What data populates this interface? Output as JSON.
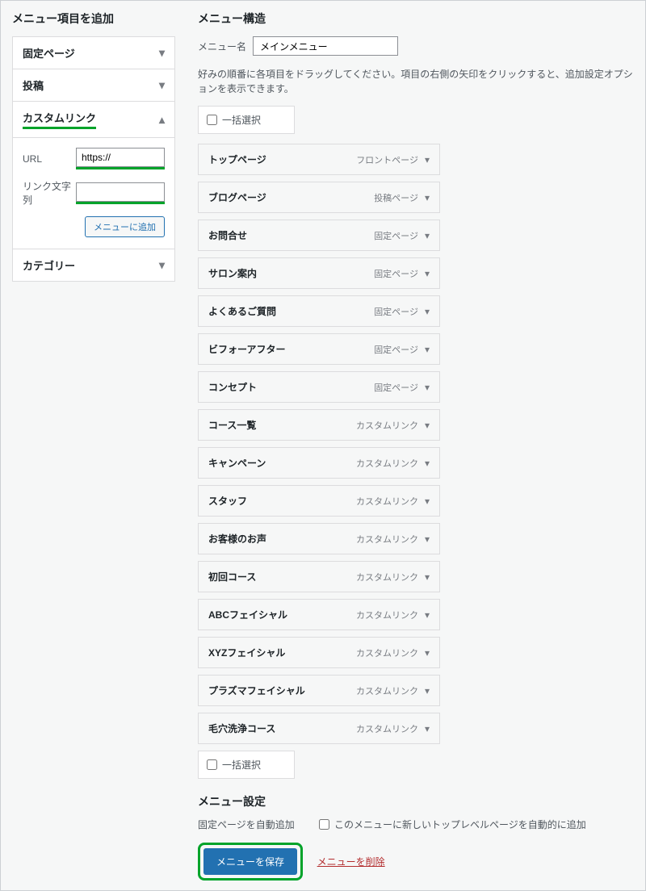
{
  "left": {
    "heading": "メニュー項目を追加",
    "panels": [
      {
        "label": "固定ページ",
        "open": false
      },
      {
        "label": "投稿",
        "open": false
      },
      {
        "label": "カスタムリンク",
        "open": true
      },
      {
        "label": "カテゴリー",
        "open": false
      }
    ],
    "custom_link": {
      "url_label": "URL",
      "url_value": "https://",
      "text_label": "リンク文字列",
      "text_value": "",
      "add_btn": "メニューに追加"
    }
  },
  "right": {
    "heading": "メニュー構造",
    "menu_name_label": "メニュー名",
    "menu_name_value": "メインメニュー",
    "instructions": "好みの順番に各項目をドラッグしてください。項目の右側の矢印をクリックすると、追加設定オプションを表示できます。",
    "bulk_select": "一括選択",
    "items": [
      {
        "title": "トップページ",
        "type": "フロントページ"
      },
      {
        "title": "ブログページ",
        "type": "投稿ページ"
      },
      {
        "title": "お問合せ",
        "type": "固定ページ"
      },
      {
        "title": "サロン案内",
        "type": "固定ページ"
      },
      {
        "title": "よくあるご質問",
        "type": "固定ページ"
      },
      {
        "title": "ビフォーアフター",
        "type": "固定ページ"
      },
      {
        "title": "コンセプト",
        "type": "固定ページ"
      },
      {
        "title": "コース一覧",
        "type": "カスタムリンク"
      },
      {
        "title": "キャンペーン",
        "type": "カスタムリンク"
      },
      {
        "title": "スタッフ",
        "type": "カスタムリンク"
      },
      {
        "title": "お客様のお声",
        "type": "カスタムリンク"
      },
      {
        "title": "初回コース",
        "type": "カスタムリンク"
      },
      {
        "title": "ABCフェイシャル",
        "type": "カスタムリンク"
      },
      {
        "title": "XYZフェイシャル",
        "type": "カスタムリンク"
      },
      {
        "title": "プラズマフェイシャル",
        "type": "カスタムリンク"
      },
      {
        "title": "毛穴洗浄コース",
        "type": "カスタムリンク"
      }
    ],
    "settings": {
      "heading": "メニュー設定",
      "auto_add_label": "固定ページを自動追加",
      "auto_add_check": "このメニューに新しいトップレベルページを自動的に追加"
    },
    "save_btn": "メニューを保存",
    "delete_link": "メニューを削除"
  }
}
